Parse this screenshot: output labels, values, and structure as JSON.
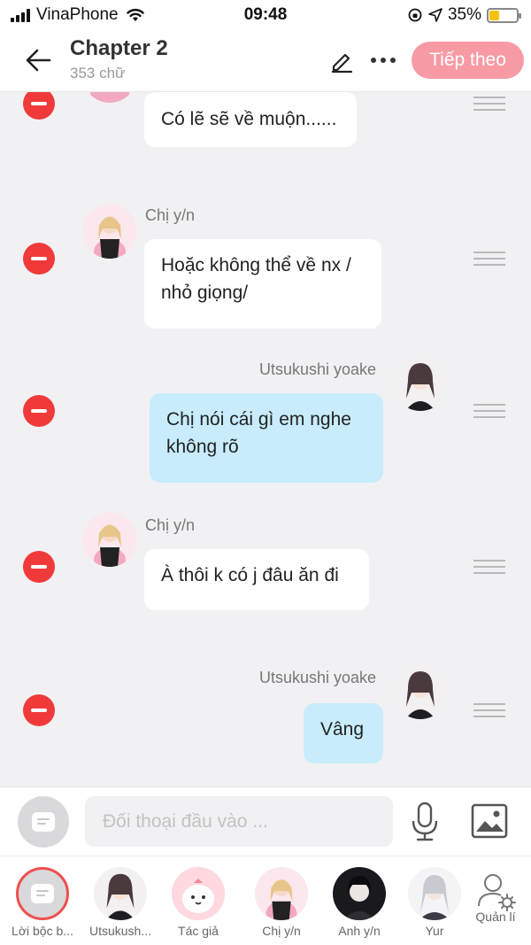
{
  "status_bar": {
    "carrier": "VinaPhone",
    "time": "09:48",
    "battery_percent": "35%",
    "battery_level": 0.35
  },
  "header": {
    "title": "Chapter 2",
    "subtitle": "353 chữ",
    "next_label": "Tiếp theo",
    "accent_color": "#f79aa4"
  },
  "messages": [
    {
      "side": "left",
      "speaker": "",
      "text": "Có lẽ sẽ về muộn......"
    },
    {
      "side": "left",
      "speaker": "Chị y/n",
      "text": "Hoặc không thể về nx / nhỏ giọng/"
    },
    {
      "side": "right",
      "speaker": "Utsukushi yoake",
      "text": "Chị nói cái gì em nghe không rõ"
    },
    {
      "side": "left",
      "speaker": "Chị y/n",
      "text": "À thôi k có j đâu ăn đi"
    },
    {
      "side": "right",
      "speaker": "Utsukushi yoake",
      "text": "Vâng"
    }
  ],
  "input": {
    "placeholder": "Đối thoại đầu vào ...",
    "value": ""
  },
  "characters": [
    {
      "label": "Lời bộc b...",
      "icon": "narration-icon"
    },
    {
      "label": "Utsukush...",
      "icon": "avatar-dark-hair-girl"
    },
    {
      "label": "Tác giả",
      "icon": "avatar-pink-mascot"
    },
    {
      "label": "Chị y/n",
      "icon": "avatar-blonde-girl"
    },
    {
      "label": "Anh y/n",
      "icon": "avatar-dark-boy"
    },
    {
      "label": "Yur",
      "icon": "avatar-silver-hair-girl"
    }
  ],
  "manage_label": "Quản lí"
}
